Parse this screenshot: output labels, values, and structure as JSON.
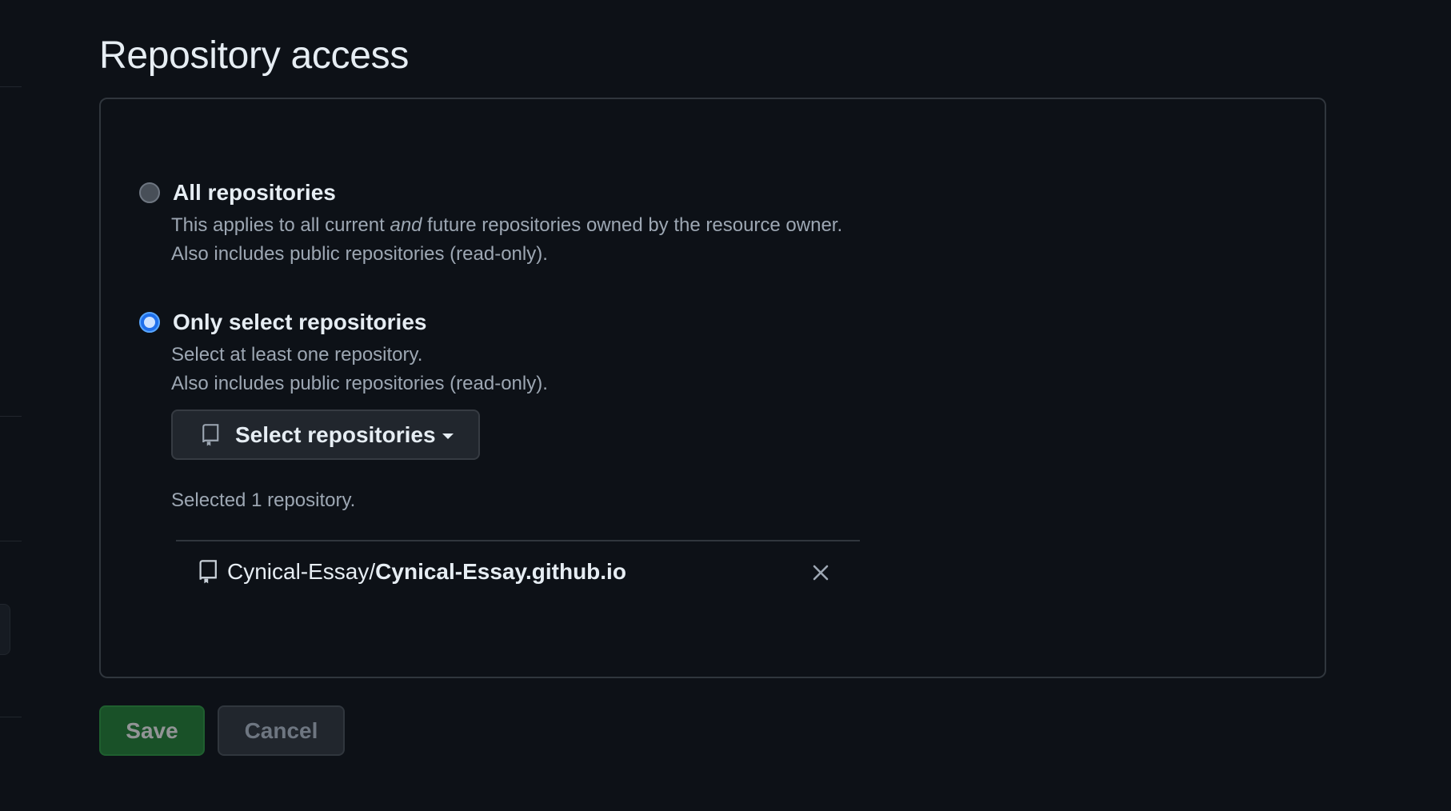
{
  "page": {
    "title": "Repository access"
  },
  "options": [
    {
      "label": "All repositories",
      "selected": false,
      "desc_line1_before": "This applies to all current ",
      "desc_line1_emph": "and",
      "desc_line1_after": " future repositories owned by the resource owner.",
      "desc_line2": "Also includes public repositories (read-only)."
    },
    {
      "label": "Only select repositories",
      "selected": true,
      "desc_line1": "Select at least one repository.",
      "desc_line2": "Also includes public repositories (read-only)."
    }
  ],
  "select_button": {
    "label": "Select repositories",
    "icon": "repo-icon"
  },
  "selection": {
    "count_text": "Selected 1 repository.",
    "repos": [
      {
        "owner": "Cynical-Essay/",
        "name": "Cynical-Essay.github.io",
        "icon": "repo-icon",
        "remove_icon": "x-icon"
      }
    ]
  },
  "actions": {
    "save_label": "Save",
    "cancel_label": "Cancel"
  },
  "colors": {
    "background": "#0d1117",
    "save_green": "#238636",
    "radio_accent": "#1f6feb"
  }
}
